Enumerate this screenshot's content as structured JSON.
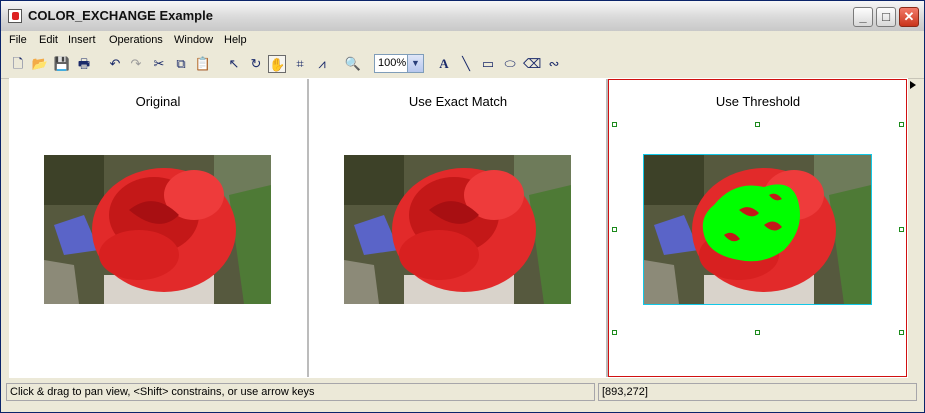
{
  "window": {
    "title": "COLOR_EXCHANGE Example",
    "minimize_glyph": "_",
    "maximize_glyph": "□",
    "close_glyph": "✕"
  },
  "menubar": {
    "items": [
      "File",
      "Edit",
      "Insert",
      "Operations",
      "Window",
      "Help"
    ]
  },
  "toolbar": {
    "icons": [
      "new-file-icon",
      "open-folder-icon",
      "save-icon",
      "print-icon",
      "undo-icon",
      "redo-icon",
      "cut-icon",
      "copy-icon",
      "paste-icon",
      "select-arrow-icon",
      "rotate-icon",
      "pan-hand-icon",
      "crop-icon",
      "histogram-icon",
      "zoom-magnifier-icon",
      "text-tool-icon",
      "line-tool-icon",
      "rectangle-tool-icon",
      "ellipse-tool-icon",
      "eraser-tool-icon",
      "freehand-tool-icon"
    ],
    "zoom_value": "100%",
    "glyphs": {
      "new": "🗋",
      "open": "📂",
      "save": "💾",
      "print": "🖶",
      "undo": "↶",
      "redo": "↷",
      "cut": "✂",
      "copy": "⧉",
      "paste": "📋",
      "select": "↖",
      "rotate": "↻",
      "pan": "✋",
      "crop": "⌗",
      "histogram": "⩘",
      "zoom": "🔍",
      "text": "A",
      "line": "╲",
      "rect": "▭",
      "ellipse": "⬭",
      "eraser": "⌫",
      "freehand": "∾"
    }
  },
  "panels": [
    {
      "title": "Original"
    },
    {
      "title": "Use Exact Match"
    },
    {
      "title": "Use Threshold"
    }
  ],
  "statusbar": {
    "hint": "Click & drag to pan view, <Shift> constrains, or use arrow keys",
    "coordinates": "[893,272]"
  },
  "colors": {
    "selection_border": "#d01010",
    "handle": "#1c8a1c",
    "image_highlight": "#12c8e8",
    "threshold_fill": "#00ff00"
  }
}
